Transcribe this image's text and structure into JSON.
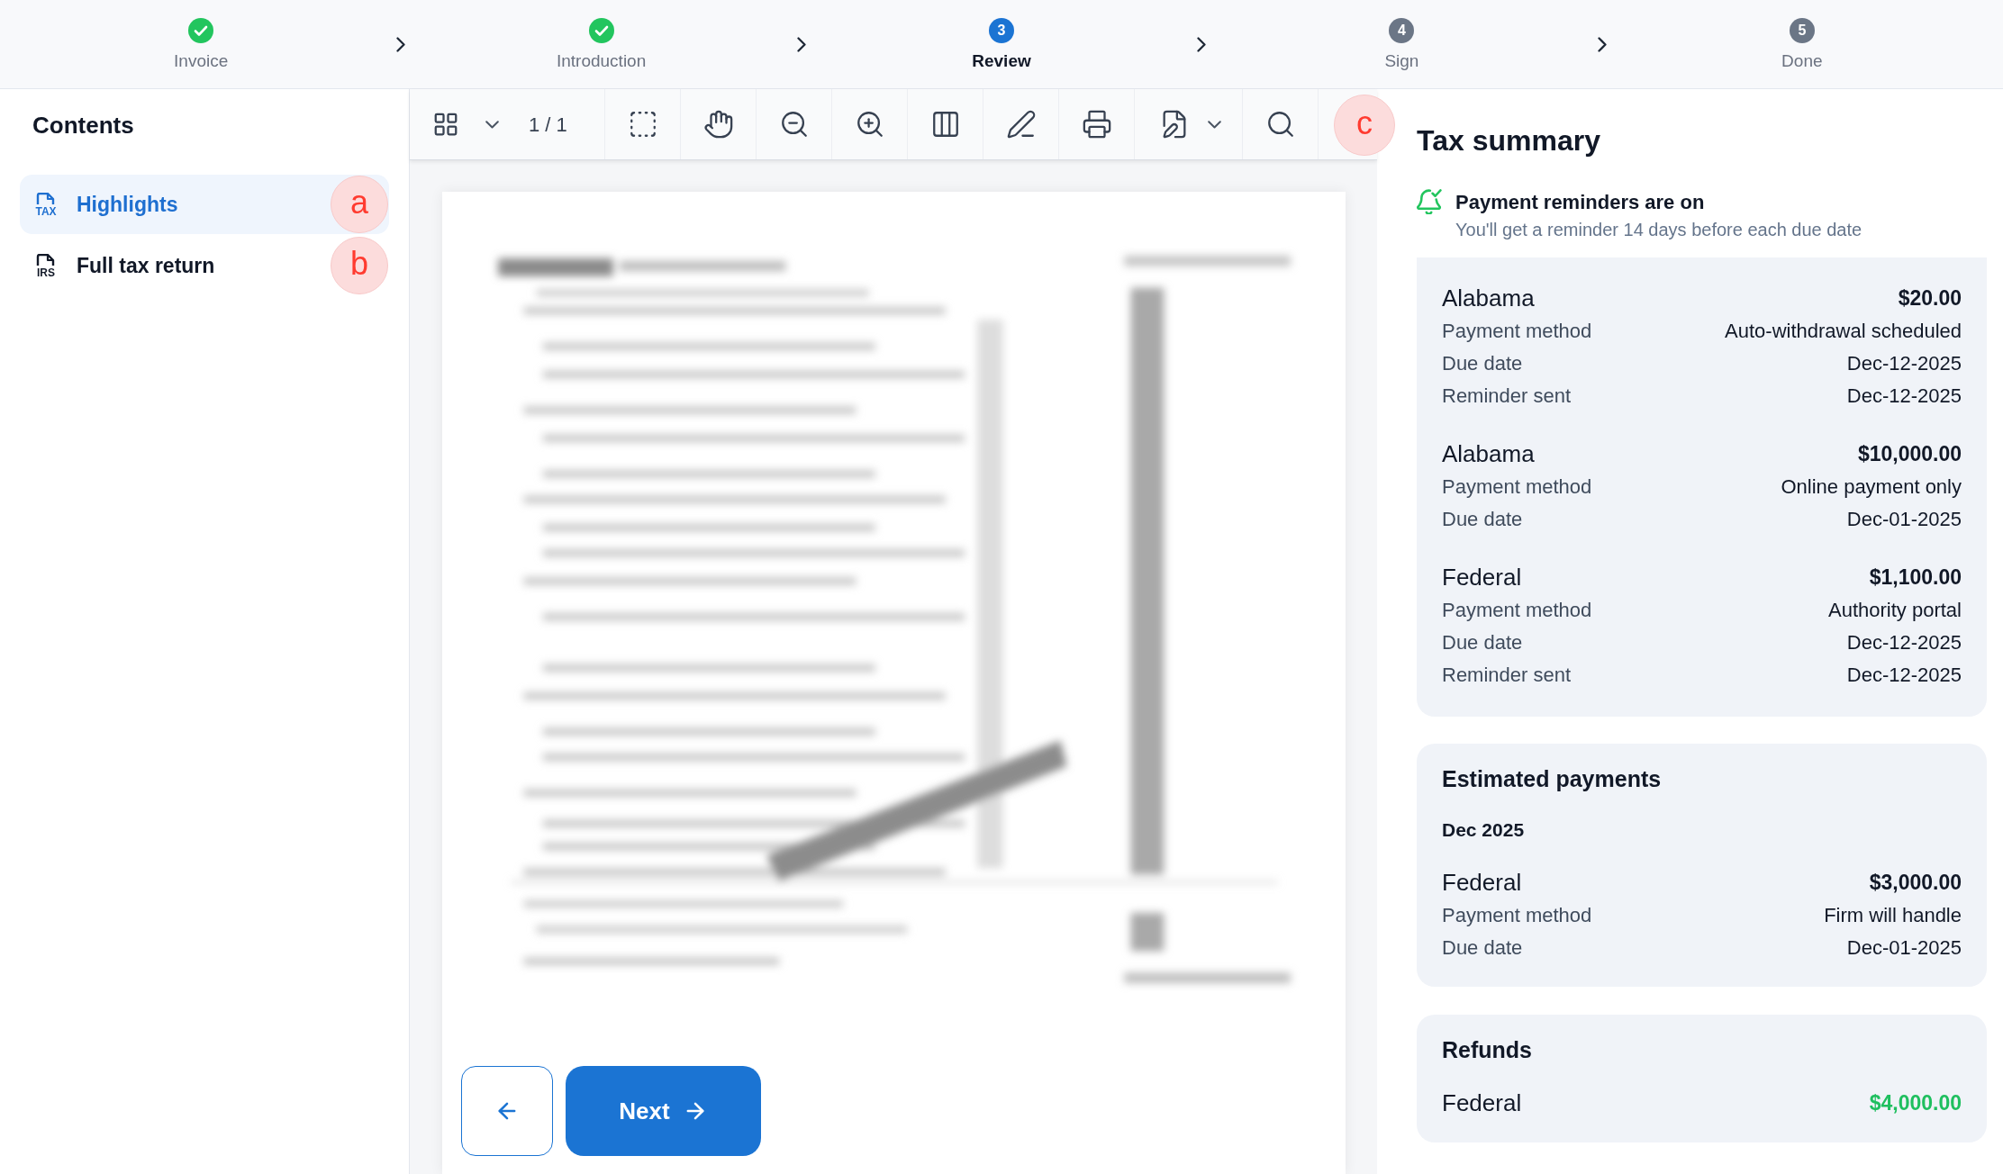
{
  "stepper": {
    "steps": [
      {
        "label": "Invoice",
        "completed": true,
        "selected": false
      },
      {
        "label": "Introduction",
        "completed": true,
        "selected": false
      },
      {
        "label": "Review",
        "number": "3",
        "completed": false,
        "selected": true
      },
      {
        "label": "Sign",
        "number": "4",
        "completed": false,
        "selected": false
      },
      {
        "label": "Done",
        "number": "5",
        "completed": false,
        "selected": false
      }
    ]
  },
  "sidebar": {
    "title": "Contents",
    "items": [
      {
        "label": "Highlights",
        "icon_label": "TAX",
        "selected": true,
        "marker": "a"
      },
      {
        "label": "Full tax return",
        "icon_label": "IRS",
        "selected": false,
        "marker": "b"
      }
    ]
  },
  "viewer": {
    "toolbar": {
      "page_indicator": "1 / 1",
      "marker": "c"
    },
    "navigation": {
      "next_label": "Next"
    }
  },
  "tax_summary": {
    "title": "Tax summary",
    "reminder": {
      "on": true,
      "title": "Payment reminders are on",
      "note": "You'll get a reminder 14 days before each due date"
    },
    "sections": [
      {
        "kind": "payments",
        "groups": [
          {
            "name": "Alabama",
            "amount": "$20.00",
            "details": [
              {
                "label": "Payment method",
                "value": "Auto-withdrawal scheduled"
              },
              {
                "label": "Due date",
                "value": "Dec-12-2025"
              },
              {
                "label": "Reminder sent",
                "value": "Dec-12-2025"
              }
            ]
          },
          {
            "name": "Alabama",
            "amount": "$10,000.00",
            "details": [
              {
                "label": "Payment method",
                "value": "Online payment only"
              },
              {
                "label": "Due date",
                "value": "Dec-01-2025"
              }
            ]
          },
          {
            "name": "Federal",
            "amount": "$1,100.00",
            "details": [
              {
                "label": "Payment method",
                "value": "Authority portal"
              },
              {
                "label": "Due date",
                "value": "Dec-12-2025"
              },
              {
                "label": "Reminder sent",
                "value": "Dec-12-2025"
              }
            ]
          }
        ]
      },
      {
        "kind": "estimated",
        "title": "Estimated payments",
        "period": "Dec 2025",
        "groups": [
          {
            "name": "Federal",
            "amount": "$3,000.00",
            "details": [
              {
                "label": "Payment method",
                "value": "Firm will handle"
              },
              {
                "label": "Due date",
                "value": "Dec-01-2025"
              }
            ]
          }
        ]
      },
      {
        "kind": "refunds",
        "title": "Refunds",
        "groups": [
          {
            "name": "Federal",
            "amount": "$4,000.00"
          }
        ]
      }
    ]
  }
}
